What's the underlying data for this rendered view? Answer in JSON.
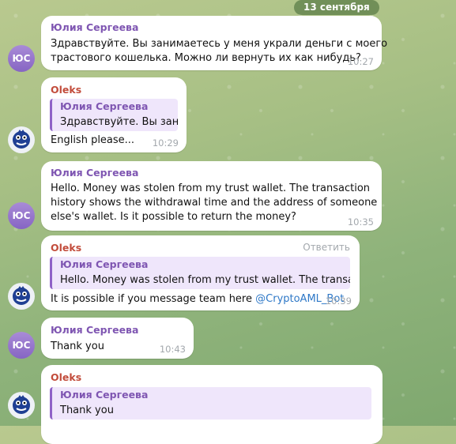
{
  "chat": {
    "date_separator": "13 сентября",
    "reply_action_label": "Ответить",
    "avatars": {
      "julia_initials": "ЮС"
    },
    "messages": [
      {
        "sender": "Юлия Сергеева",
        "lines": [
          "Здравствуйте. Вы занимаетесь у меня украли деньги с моего",
          "трастового кошелька. Можно ли вернуть их как нибудь?"
        ],
        "time": "10:27"
      },
      {
        "sender": "Oleks",
        "quote_sender": "Юлия Сергеева",
        "quote_text": "Здравствуйте. Вы зани...",
        "text": "English please...",
        "time": "10:29"
      },
      {
        "sender": "Юлия Сергеева",
        "lines": [
          "Hello. Money was stolen from my trust wallet. The transaction",
          "history shows the withdrawal time and the address of someone",
          "else's wallet. Is it possible to return the money?"
        ],
        "time": "10:35"
      },
      {
        "sender": "Oleks",
        "quote_sender": "Юлия Сергеева",
        "quote_text": "Hello. Money was stolen from my trust wallet. The transacti...",
        "text_prefix": "It is possible if you message team here",
        "link": "@CryptoAML_Bot",
        "time": "10:39"
      },
      {
        "sender": "Юлия Сергеева",
        "text": "Thank you",
        "time": "10:43"
      },
      {
        "sender": "Oleks",
        "quote_sender": "Юлия Сергеева",
        "quote_text": "Thank you"
      }
    ]
  },
  "colors": {
    "julia_name": "#7f56b2",
    "oleks_name": "#c24c3b",
    "link": "#2e78c7",
    "quote_bg": "#efe6fb",
    "quote_bar": "#8f62c7"
  },
  "icons": {
    "oleks_avatar": "blue-furry-monster-avatar-icon"
  }
}
